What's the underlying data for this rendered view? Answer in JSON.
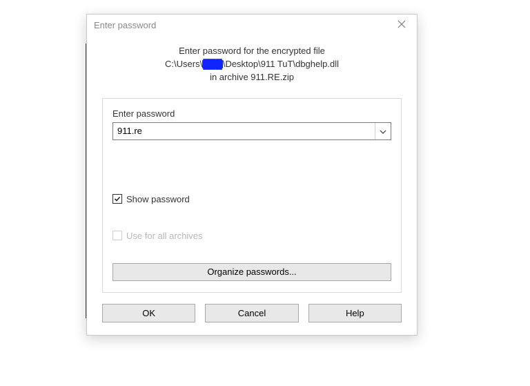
{
  "titlebar": {
    "title": "Enter password"
  },
  "message": {
    "line1": "Enter password for the encrypted file",
    "path_prefix": "C:\\Users\\",
    "path_redacted": "███",
    "path_suffix": "\\Desktop\\911 TuT\\dbghelp.dll",
    "line3": "in archive 911.RE.zip"
  },
  "group": {
    "password_label": "Enter password",
    "password_value": "911.re",
    "show_password_label": "Show password",
    "show_password_checked": true,
    "use_all_label": "Use for all archives",
    "use_all_checked": false,
    "organize_label": "Organize passwords..."
  },
  "buttons": {
    "ok": "OK",
    "cancel": "Cancel",
    "help": "Help"
  }
}
